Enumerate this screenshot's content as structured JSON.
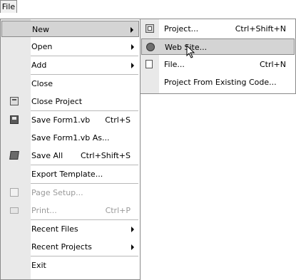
{
  "menubar": {
    "file_label": "File"
  },
  "file_menu": {
    "items": [
      {
        "label": "New",
        "submenu": true,
        "highlight": true
      },
      {
        "label": "Open",
        "submenu": true
      },
      {
        "label": "Add",
        "submenu": true
      },
      {
        "label": "Close"
      },
      {
        "label": "Close Project",
        "icon": "close-project-icon"
      },
      {
        "label": "Save Form1.vb",
        "shortcut": "Ctrl+S",
        "icon": "save-icon"
      },
      {
        "label": "Save Form1.vb As..."
      },
      {
        "label": "Save All",
        "shortcut": "Ctrl+Shift+S",
        "icon": "save-all-icon"
      },
      {
        "label": "Export Template..."
      },
      {
        "label": "Page Setup...",
        "disabled": true,
        "icon": "page-setup-icon"
      },
      {
        "label": "Print...",
        "shortcut": "Ctrl+P",
        "disabled": true,
        "icon": "print-icon"
      },
      {
        "label": "Recent Files",
        "submenu": true
      },
      {
        "label": "Recent Projects",
        "submenu": true
      },
      {
        "label": "Exit"
      }
    ]
  },
  "new_submenu": {
    "items": [
      {
        "label": "Project...",
        "shortcut": "Ctrl+Shift+N",
        "icon": "project-icon"
      },
      {
        "label": "Web Site...",
        "icon": "web-site-icon",
        "highlight": true
      },
      {
        "label": "File...",
        "shortcut": "Ctrl+N",
        "icon": "file-icon"
      },
      {
        "label": "Project From Existing Code..."
      }
    ]
  }
}
